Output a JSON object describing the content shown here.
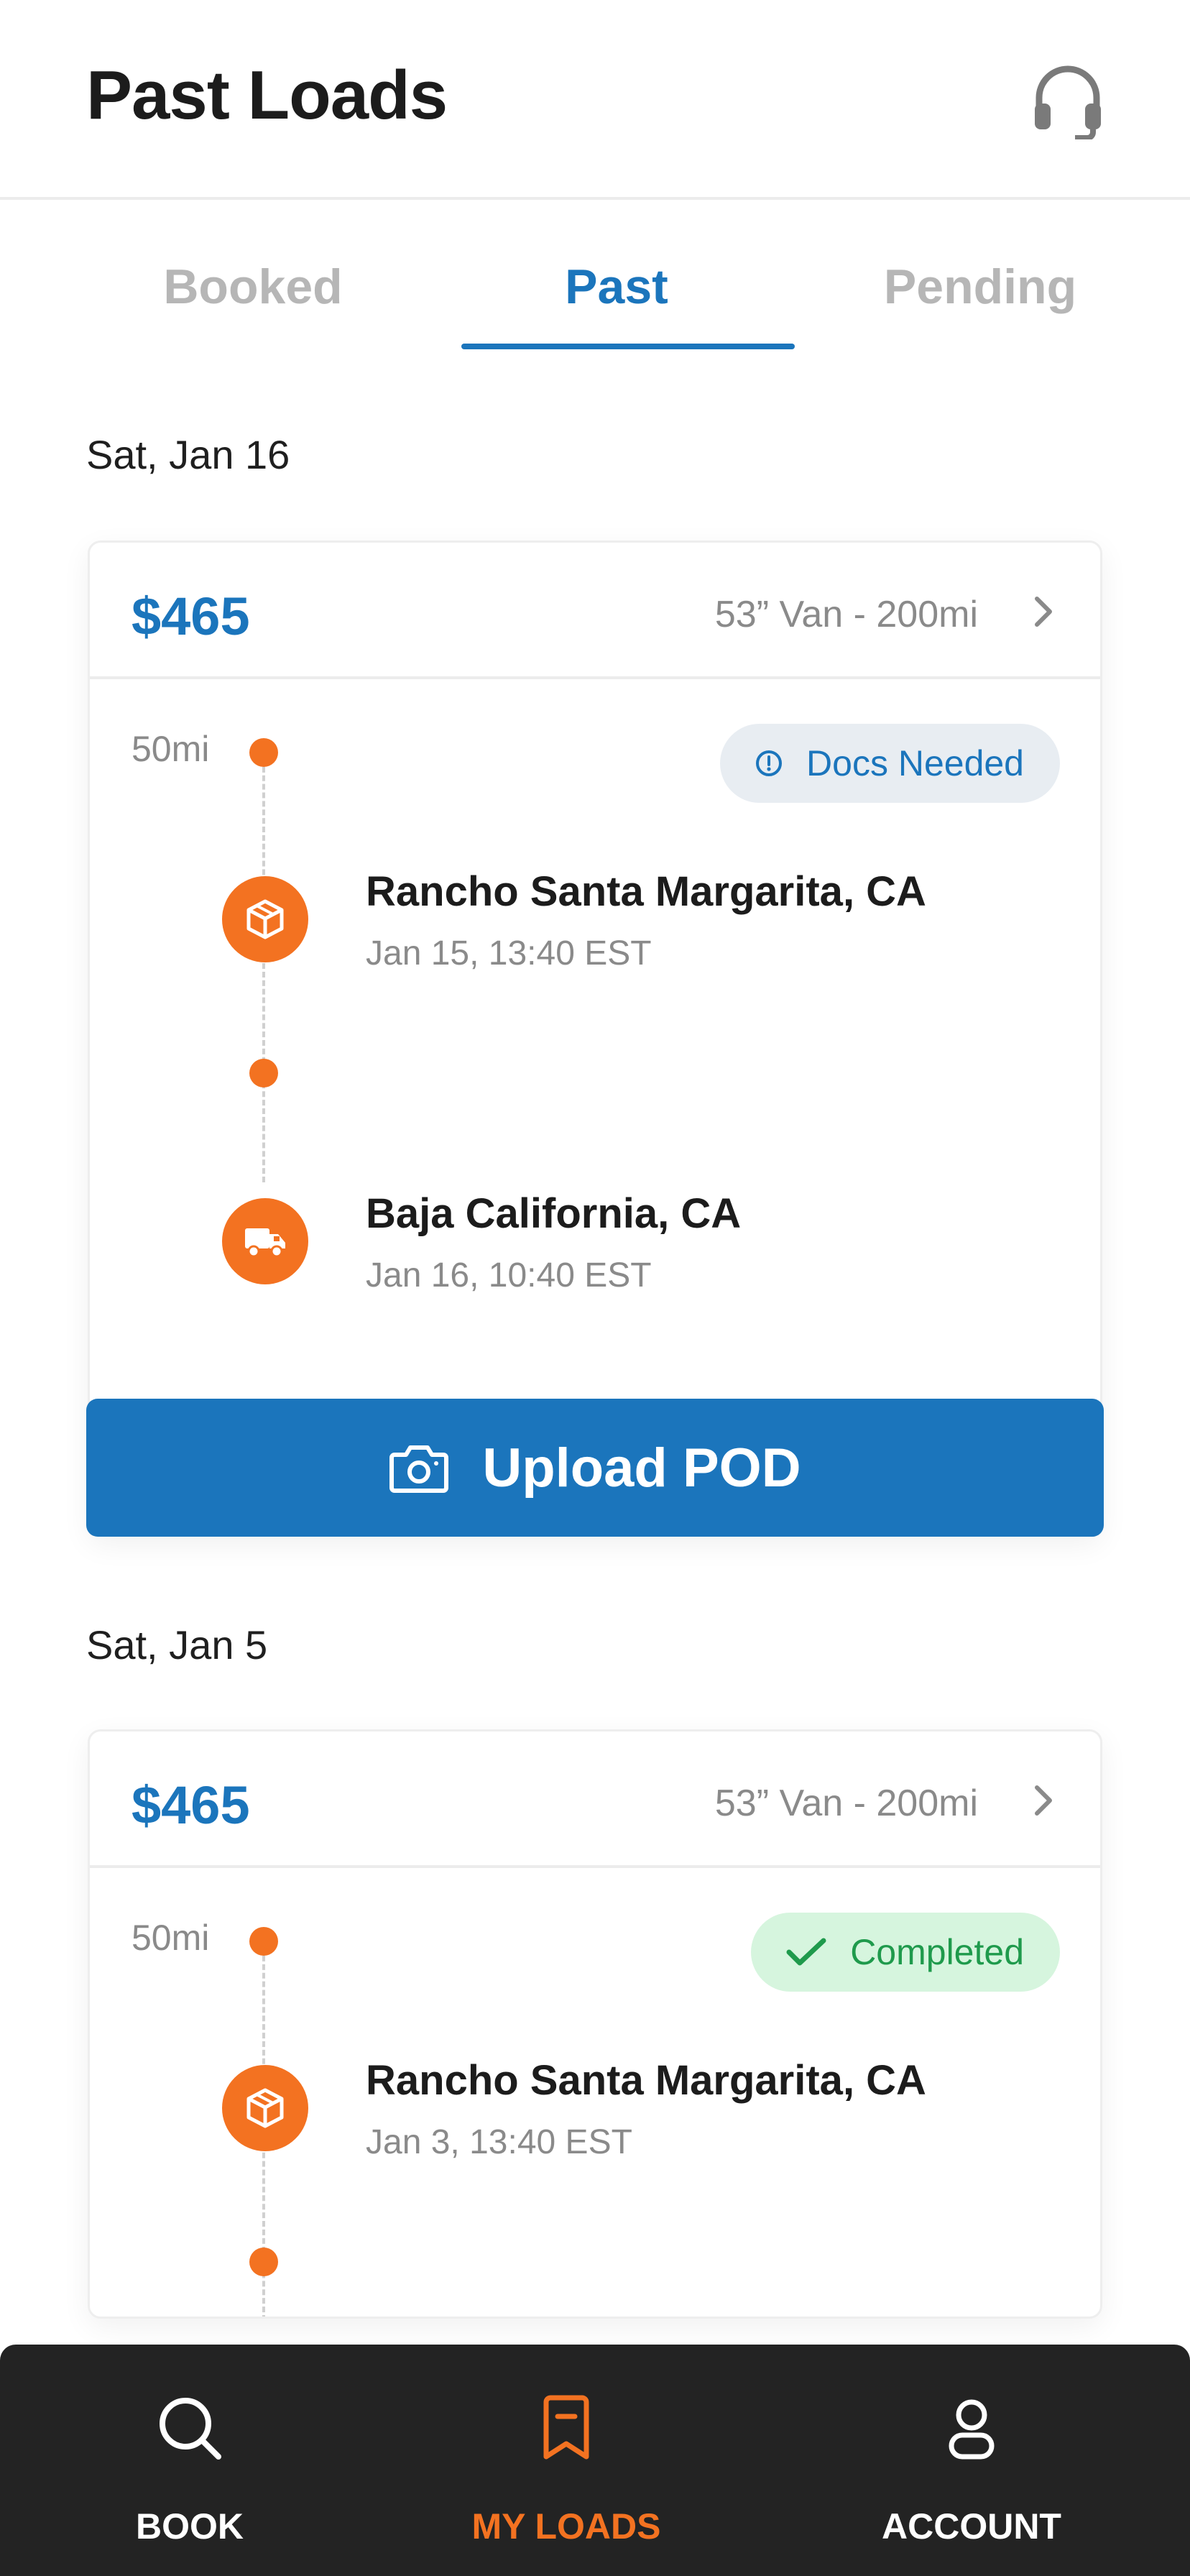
{
  "header": {
    "title": "Past Loads",
    "support_icon": "headset-icon"
  },
  "tabs": [
    {
      "label": "Booked",
      "active": false
    },
    {
      "label": "Past",
      "active": true
    },
    {
      "label": "Pending",
      "active": false
    }
  ],
  "loads": [
    {
      "date": "Sat, Jan 16",
      "price": "$465",
      "equipment": "53” Van - 200mi",
      "deadhead": "50mi",
      "status": "Docs Needed",
      "status_type": "docs",
      "pickup": {
        "city": "Rancho Santa Margarita, CA",
        "time": "Jan 15, 13:40 EST",
        "icon": "package-icon"
      },
      "dropoff": {
        "city": "Baja California, CA",
        "time": "Jan 16, 10:40 EST",
        "icon": "truck-icon"
      },
      "action": "Upload POD"
    },
    {
      "date": "Sat, Jan 5",
      "price": "$465",
      "equipment": "53” Van - 200mi",
      "deadhead": "50mi",
      "status": "Completed",
      "status_type": "done",
      "pickup": {
        "city": "Rancho Santa Margarita, CA",
        "time": "Jan 3, 13:40 EST",
        "icon": "package-icon"
      }
    }
  ],
  "bottom_nav": [
    {
      "label": "BOOK",
      "icon": "search-icon",
      "active": false
    },
    {
      "label": "MY LOADS",
      "icon": "bookmark-icon",
      "active": true
    },
    {
      "label": "ACCOUNT",
      "icon": "user-icon",
      "active": false
    }
  ],
  "colors": {
    "accent": "#1b75bc",
    "orange": "#f37221",
    "nav_bg": "#232323",
    "success": "#1f9a4c"
  }
}
